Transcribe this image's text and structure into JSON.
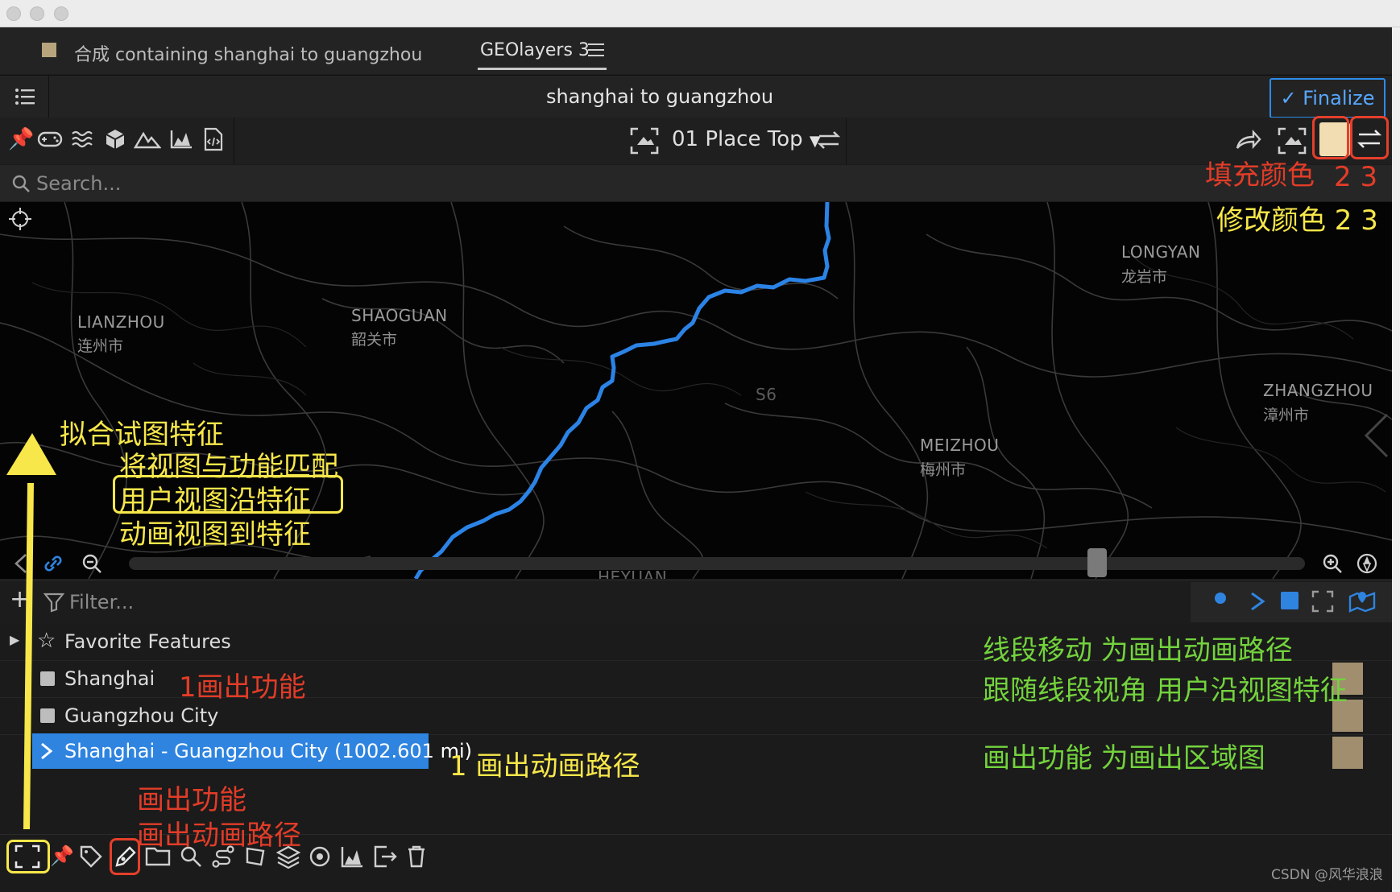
{
  "tabs": {
    "composition_tab": "合成 containing shanghai to guangzhou",
    "plugin_tab": "GEOlayers 3"
  },
  "header": {
    "title": "shanghai to guangzhou",
    "finalize_label": "Finalize"
  },
  "toolbar": {
    "preset_label": "01 Place Top",
    "fill_color": "#f2dcb1"
  },
  "search": {
    "placeholder": "Search..."
  },
  "map": {
    "route_color": "#2b83e6",
    "labels": [
      {
        "en": "LIANZHOU",
        "zh": "连州市"
      },
      {
        "en": "SHAOGUAN",
        "zh": "韶关市"
      },
      {
        "en": "LONGYAN",
        "zh": "龙岩市"
      },
      {
        "en": "MEIZHOU",
        "zh": "梅州市"
      },
      {
        "en": "ZHANGZHOU",
        "zh": "漳州市"
      },
      {
        "en": "S6",
        "zh": ""
      },
      {
        "en": "HEYUAN",
        "zh": ""
      }
    ]
  },
  "filter": {
    "placeholder": "Filter..."
  },
  "list": {
    "favorites": "Favorite Features",
    "items": [
      {
        "label": "Shanghai"
      },
      {
        "label": "Guangzhou City"
      }
    ],
    "selected": "Shanghai - Guangzhou City (1002.601 mi)"
  },
  "annotations": {
    "fill_color": "填充颜色",
    "fill_color_num": "2 3",
    "modify_color": "修改颜色 2 3",
    "fit_view_1": "拟合试图特征",
    "fit_view_2": "将视图与功能匹配",
    "fit_view_3": "用户视图沿特征",
    "fit_view_4": "动画视图到特征",
    "draw_feature_1": "1画出功能",
    "draw_path_1": "1 画出动画路径",
    "draw_feature_2": "画出功能",
    "draw_path_2": "画出动画路径",
    "green_1": "线段移动 为画出动画路径",
    "green_2": "跟随线段视角 用户沿视图特征",
    "green_3": "画出功能 为画出区域图"
  },
  "watermark": "CSDN @风华浪浪"
}
